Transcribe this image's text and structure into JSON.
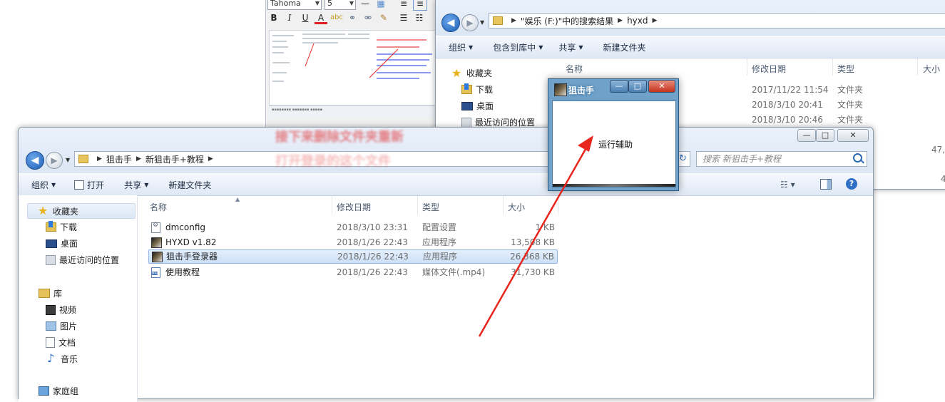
{
  "doc_window": {
    "font_name": "Tahoma",
    "font_size": "5",
    "format_buttons": [
      "B",
      "I",
      "U",
      "A"
    ],
    "overlay_text_1": "接下来删除文件夹重新",
    "overlay_text_2": "打开登录的这个文件"
  },
  "back_explorer": {
    "breadcrumb": [
      "\"娱乐 (F:)\"中的搜索结果",
      "hyxd"
    ],
    "toolbar": {
      "organize": "组织",
      "include_library": "包含到库中",
      "share": "共享",
      "new_folder": "新建文件夹"
    },
    "nav": {
      "favorites": "收藏夹",
      "downloads": "下载",
      "desktop": "桌面",
      "recent": "最近访问的位置"
    },
    "columns": {
      "name": "名称",
      "modified": "修改日期",
      "type": "类型",
      "size": "大小"
    },
    "rows": [
      {
        "modified": "2017/11/22 11:54",
        "type": "文件夹"
      },
      {
        "modified": "2018/3/10 20:41",
        "type": "文件夹"
      },
      {
        "modified": "2018/3/10 20:46",
        "type": "文件夹"
      }
    ],
    "size_fragments": [
      "47,1",
      "4"
    ]
  },
  "front_explorer": {
    "breadcrumb": [
      "狙击手",
      "新狙击手+教程"
    ],
    "search_placeholder": "搜索 新狙击手+教程",
    "toolbar": {
      "organize": "组织",
      "open": "打开",
      "share": "共享",
      "new_folder": "新建文件夹"
    },
    "nav": {
      "favorites": "收藏夹",
      "downloads": "下载",
      "desktop": "桌面",
      "recent": "最近访问的位置",
      "libraries": "库",
      "videos": "视频",
      "pictures": "图片",
      "documents": "文档",
      "music": "音乐",
      "homegroup": "家庭组"
    },
    "columns": {
      "name": "名称",
      "modified": "修改日期",
      "type": "类型",
      "size": "大小"
    },
    "files": [
      {
        "name": "dmconfig",
        "modified": "2018/3/10 23:31",
        "type": "配置设置",
        "size": "1 KB",
        "icon": "config-file-icon"
      },
      {
        "name": "HYXD v1.82",
        "modified": "2018/1/26 22:43",
        "type": "应用程序",
        "size": "13,508 KB",
        "icon": "app-exe-icon"
      },
      {
        "name": "狙击手登录器",
        "modified": "2018/1/26 22:43",
        "type": "应用程序",
        "size": "26,368 KB",
        "icon": "app-exe-icon",
        "selected": true
      },
      {
        "name": "使用教程",
        "modified": "2018/1/26 22:43",
        "type": "媒体文件(.mp4)",
        "size": "31,730 KB",
        "icon": "mp4-file-icon"
      }
    ]
  },
  "sniper_dialog": {
    "title": "狙击手",
    "body_text": "运行辅助",
    "minimize": "—",
    "maximize": "□",
    "close": "✕"
  },
  "annotation_color": "#e8261e"
}
